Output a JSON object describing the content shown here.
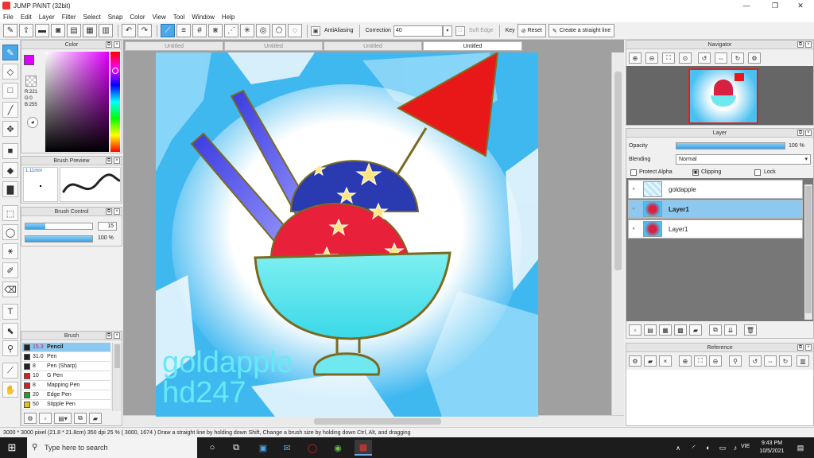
{
  "window": {
    "title": "JUMP PAINT (32bit)",
    "minimize": "—",
    "maximize": "❐",
    "close": "✕"
  },
  "menu": [
    "File",
    "Edit",
    "Layer",
    "Filter",
    "Select",
    "Snap",
    "Color",
    "View",
    "Tool",
    "Window",
    "Help"
  ],
  "toolbar": {
    "antialiasing_label": "AntiAliasing",
    "correction_label": "Correction",
    "correction_value": "40",
    "soft_edge_label": "Soft Edge",
    "key_label": "Key",
    "reset_label": "Reset",
    "straight_line_label": "Create a straight line"
  },
  "doc_tabs": [
    "Untitled",
    "Untitled",
    "Untitled",
    "Untitled"
  ],
  "color_panel": {
    "title": "Color",
    "r": "R:221",
    "g": "G:0",
    "b": "B:255",
    "fg_color": "#dd00ff",
    "bg_color": "#000000"
  },
  "brush_preview": {
    "title": "Brush Preview",
    "size": "1.11mm"
  },
  "brush_control": {
    "title": "Brush Control",
    "size_value": "15",
    "opacity_value": "100 %",
    "size_fraction": 0.3,
    "opacity_fraction": 1.0
  },
  "brush_panel": {
    "title": "Brush",
    "items": [
      {
        "size": "15.3",
        "name": "Pencil",
        "color": "#222222",
        "selected": true
      },
      {
        "size": "31.0",
        "name": "Pen",
        "color": "#222222",
        "selected": false
      },
      {
        "size": "8",
        "name": "Pen (Sharp)",
        "color": "#222222",
        "selected": false
      },
      {
        "size": "10",
        "name": "G Pen",
        "color": "#d62020",
        "selected": false
      },
      {
        "size": "8",
        "name": "Mapping Pen",
        "color": "#d62020",
        "selected": false
      },
      {
        "size": "20",
        "name": "Edge Pen",
        "color": "#2a9a2a",
        "selected": false
      },
      {
        "size": "50",
        "name": "Stipple Pen",
        "color": "#e0c020",
        "selected": false
      }
    ]
  },
  "artwork": {
    "watermark_line1": "goldapple",
    "watermark_line2": "hd247"
  },
  "navigator": {
    "title": "Navigator"
  },
  "layer_panel": {
    "title": "Layer",
    "opacity_label": "Opacity",
    "opacity_value": "100 %",
    "opacity_fraction": 1.0,
    "blending_label": "Blending",
    "blending_value": "Normal",
    "protect_alpha_label": "Protect Alpha",
    "clipping_label": "Clipping",
    "lock_label": "Lock",
    "layers": [
      {
        "name": "goldapple",
        "selected": false
      },
      {
        "name": "Layer1",
        "selected": true
      },
      {
        "name": "Layer1",
        "selected": false
      }
    ]
  },
  "reference": {
    "title": "Reference"
  },
  "status": "3000 * 3000 pixel   (21.8 * 21.8cm)   350 dpi   25 %   ( 3000, 1674 )   Draw a straight line by holding down Shift, Change a brush size by holding down Ctrl, Alt, and dragging",
  "taskbar": {
    "search_placeholder": "Type here to search",
    "time": "9:43 PM",
    "date": "10/5/2021",
    "lang": "VIE"
  }
}
